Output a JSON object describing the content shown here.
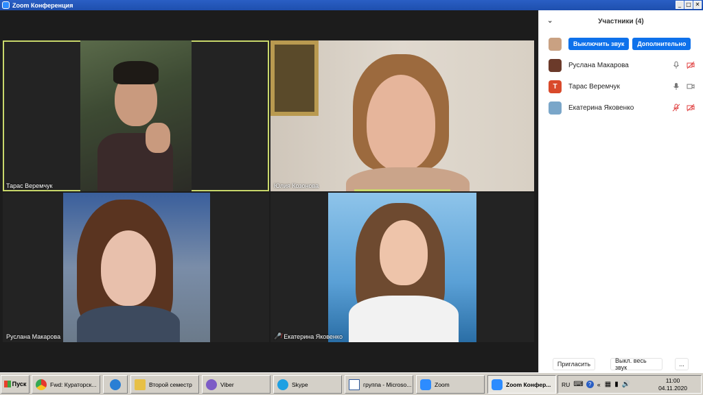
{
  "window": {
    "title": "Zoom Конференция",
    "minimize": "_",
    "maximize": "□",
    "close": "✕"
  },
  "tiles": [
    {
      "name": "Тарас Веремчук",
      "muted": false
    },
    {
      "name": "Юлия Козонова",
      "muted": false
    },
    {
      "name": "Руслана Макарова",
      "muted": false
    },
    {
      "name": "Екатерина Яковенко",
      "muted": true
    }
  ],
  "panel": {
    "title": "Участники (4)",
    "me_actions": {
      "mute_all_label": "Выключить звук",
      "more_label": "Дополнительно"
    },
    "participants": [
      {
        "name": "Руслана Макарова",
        "avatar_letter": "",
        "avatar_color": "#6b3a2a"
      },
      {
        "name": "Тарас Веремчук",
        "avatar_letter": "Т",
        "avatar_color": "#d94a2b"
      },
      {
        "name": "Екатерина Яковенко",
        "avatar_letter": "",
        "avatar_color": "#7aa6c9"
      }
    ],
    "footer": {
      "invite": "Пригласить",
      "mute_all": "Выкл. весь звук",
      "more": "..."
    }
  },
  "taskbar": {
    "start": "Пуск",
    "tasks": [
      {
        "label": "Fwd: Кураторск...",
        "color": "#e5382e"
      },
      {
        "label": "",
        "color": "#2a7fd4"
      },
      {
        "label": "Второй семестр",
        "color": "#e7c046"
      },
      {
        "label": "Viber",
        "color": "#7d5cc6"
      },
      {
        "label": "Skype",
        "color": "#1ea0e2"
      },
      {
        "label": "группа - Microso...",
        "color": "#ffffff"
      },
      {
        "label": "Zoom",
        "color": "#2d8cff"
      },
      {
        "label": "Zoom Конфер...",
        "color": "#2d8cff"
      }
    ],
    "lang": "RU",
    "time": "11:00",
    "date": "04.11.2020"
  },
  "colors": {
    "accent": "#0e71eb",
    "active_speaker": "#c9d86b",
    "muted": "#e04040"
  }
}
